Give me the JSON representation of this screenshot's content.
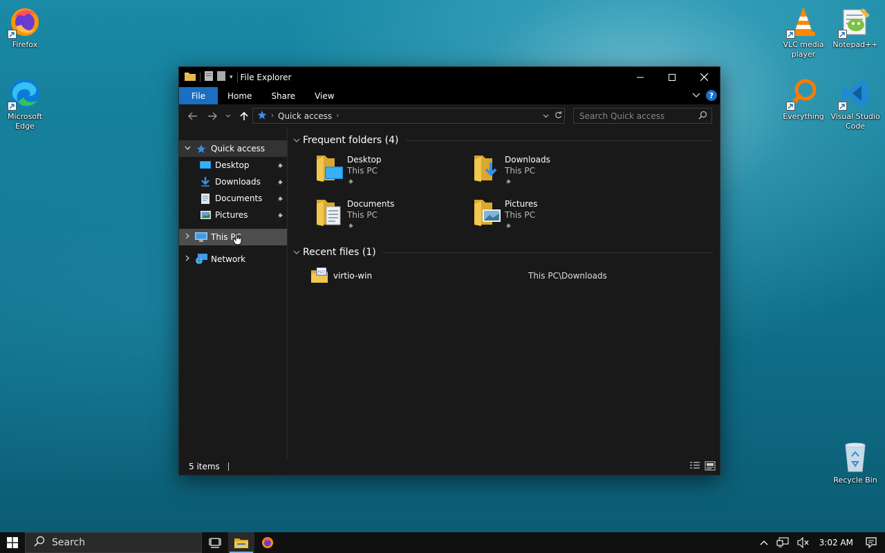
{
  "desktop": {
    "icons": [
      {
        "label": "Firefox"
      },
      {
        "label": "Microsoft Edge"
      },
      {
        "label": "VLC media player"
      },
      {
        "label": "Notepad++"
      },
      {
        "label": "Everything"
      },
      {
        "label": "Visual Studio Code"
      },
      {
        "label": "Recycle Bin"
      }
    ]
  },
  "window": {
    "title": "File Explorer",
    "tabs": [
      "File",
      "Home",
      "Share",
      "View"
    ],
    "address": {
      "location": "Quick access"
    },
    "search": {
      "placeholder": "Search Quick access"
    },
    "nav_pane": {
      "quick_access": "Quick access",
      "items": [
        {
          "label": "Desktop"
        },
        {
          "label": "Downloads"
        },
        {
          "label": "Documents"
        },
        {
          "label": "Pictures"
        }
      ],
      "this_pc": "This PC",
      "network": "Network"
    },
    "frequent": {
      "header": "Frequent folders (4)",
      "folders": [
        {
          "name": "Desktop",
          "location": "This PC"
        },
        {
          "name": "Downloads",
          "location": "This PC"
        },
        {
          "name": "Documents",
          "location": "This PC"
        },
        {
          "name": "Pictures",
          "location": "This PC"
        }
      ]
    },
    "recent": {
      "header": "Recent files (1)",
      "files": [
        {
          "name": "virtio-win",
          "path": "This PC\\Downloads"
        }
      ]
    },
    "status": {
      "items": "5 items"
    }
  },
  "taskbar": {
    "search_label": "Search",
    "clock": "3:02 AM"
  },
  "colors": {
    "accent": "#1a6fc2",
    "folder": "#f3c74e",
    "folder_dark": "#d9a82e"
  }
}
